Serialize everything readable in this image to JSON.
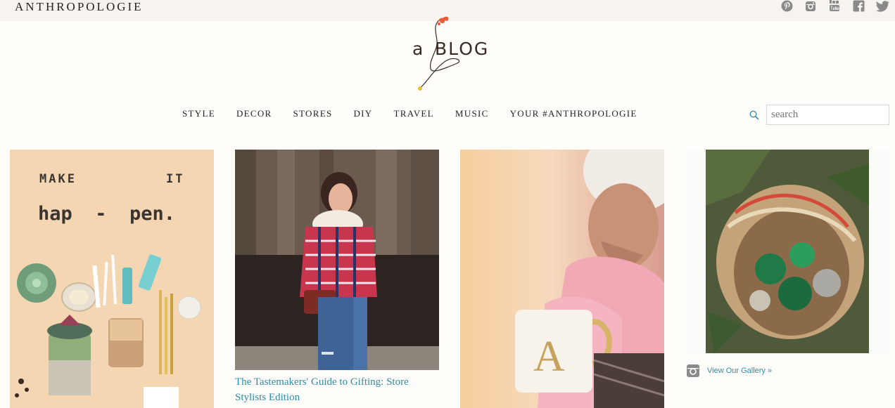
{
  "header": {
    "brand": "ANTHROPOLOGIE",
    "social_icons": [
      "pinterest-icon",
      "instagram-icon",
      "youtube-icon",
      "facebook-icon",
      "twitter-icon"
    ]
  },
  "logo": {
    "prefix": "a",
    "word": "BLOG"
  },
  "nav": {
    "items": [
      "STYLE",
      "DECOR",
      "STORES",
      "DIY",
      "TRAVEL",
      "MUSIC",
      "YOUR #ANTHROPOLOGIE"
    ]
  },
  "search": {
    "placeholder": "search"
  },
  "posts": [
    {
      "id": "make-it-happen",
      "image_text_line1_left": "MAKE",
      "image_text_line1_right": "IT",
      "image_text_line2": "hap  -  pen."
    },
    {
      "id": "tastemakers",
      "caption": "The Tastemakers' Guide to Gifting: Store Stylists Edition"
    },
    {
      "id": "mug"
    },
    {
      "id": "instagram"
    }
  ],
  "gallery": {
    "link": "View Our Gallery »"
  },
  "colors": {
    "accent": "#2f8ca6",
    "background": "#fefdf9",
    "topbar": "#f7f3ee"
  }
}
